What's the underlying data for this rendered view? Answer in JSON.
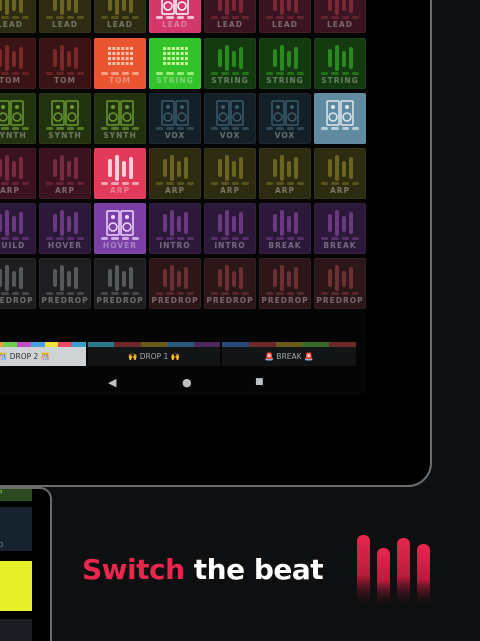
{
  "colors": {
    "accent": "#e8264e",
    "lead_active": "#d2386a",
    "tom_active": "#e85530",
    "string_active": "#34c22a",
    "synth_active": "#72b020",
    "vox_active": "#5f8aa0",
    "arp_active": "#e23a5a",
    "hover_active": "#7a3fa5"
  },
  "pad_rows": [
    {
      "row": "lead",
      "labels": [
        "",
        "LEAD",
        "LEAD",
        "LEAD",
        "LEAD",
        "LEAD",
        "LEAD",
        "LEAD"
      ]
    },
    {
      "row": "tom-string",
      "labels": [
        "",
        "TOM",
        "TOM",
        "TOM",
        "STRING",
        "STRING",
        "STRING",
        "STRING"
      ]
    },
    {
      "row": "synth-vox",
      "labels": [
        "H",
        "SYNTH",
        "SYNTH",
        "SYNTH",
        "VOX",
        "VOX",
        "VOX",
        ""
      ]
    },
    {
      "row": "arp",
      "labels": [
        "",
        "ARP",
        "ARP",
        "ARP",
        "ARP",
        "ARP",
        "ARP",
        "ARP"
      ]
    },
    {
      "row": "build-intro",
      "labels": [
        "D",
        "BUILD",
        "HOVER",
        "HOVER",
        "INTRO",
        "INTRO",
        "BREAK",
        "BREAK"
      ]
    },
    {
      "row": "predrop",
      "labels": [
        "P",
        "PREDROP",
        "PREDROP",
        "PREDROP",
        "PREDROP",
        "PREDROP",
        "PREDROP",
        "PREDROP"
      ]
    }
  ],
  "scenes": [
    {
      "label": "🎊 DROP 2 🎊",
      "active": true
    },
    {
      "label": "🙌 DROP 1 🙌",
      "active": false
    },
    {
      "label": "🚨 BREAK 🚨",
      "active": false
    }
  ],
  "nav": {
    "back": "◀",
    "home": "●",
    "recents": "■"
  },
  "phone_labels": [
    "P",
    "D"
  ],
  "headline": {
    "word1": "Switch",
    "rest": "the beat"
  },
  "logo_icon": "equalizer-bars-logo-icon"
}
